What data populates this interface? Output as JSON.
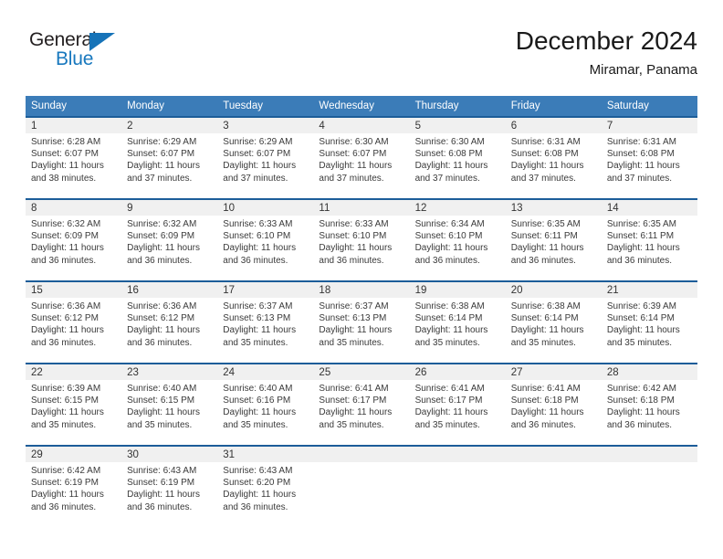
{
  "brand": {
    "name_part1": "General",
    "name_part2": "Blue",
    "triangle_color": "#1673b8",
    "text_color": "#231f20",
    "blue_color": "#1878be"
  },
  "header": {
    "title": "December 2024",
    "subtitle": "Miramar, Panama"
  },
  "theme": {
    "header_bar_color": "#3b7cb8",
    "row_divider_color": "#1c5d99",
    "day_band_color": "#f0f0f0"
  },
  "weekdays": [
    "Sunday",
    "Monday",
    "Tuesday",
    "Wednesday",
    "Thursday",
    "Friday",
    "Saturday"
  ],
  "weeks": [
    [
      {
        "day": "1",
        "sunrise": "Sunrise: 6:28 AM",
        "sunset": "Sunset: 6:07 PM",
        "daylight_line1": "Daylight: 11 hours",
        "daylight_line2": "and 38 minutes."
      },
      {
        "day": "2",
        "sunrise": "Sunrise: 6:29 AM",
        "sunset": "Sunset: 6:07 PM",
        "daylight_line1": "Daylight: 11 hours",
        "daylight_line2": "and 37 minutes."
      },
      {
        "day": "3",
        "sunrise": "Sunrise: 6:29 AM",
        "sunset": "Sunset: 6:07 PM",
        "daylight_line1": "Daylight: 11 hours",
        "daylight_line2": "and 37 minutes."
      },
      {
        "day": "4",
        "sunrise": "Sunrise: 6:30 AM",
        "sunset": "Sunset: 6:07 PM",
        "daylight_line1": "Daylight: 11 hours",
        "daylight_line2": "and 37 minutes."
      },
      {
        "day": "5",
        "sunrise": "Sunrise: 6:30 AM",
        "sunset": "Sunset: 6:08 PM",
        "daylight_line1": "Daylight: 11 hours",
        "daylight_line2": "and 37 minutes."
      },
      {
        "day": "6",
        "sunrise": "Sunrise: 6:31 AM",
        "sunset": "Sunset: 6:08 PM",
        "daylight_line1": "Daylight: 11 hours",
        "daylight_line2": "and 37 minutes."
      },
      {
        "day": "7",
        "sunrise": "Sunrise: 6:31 AM",
        "sunset": "Sunset: 6:08 PM",
        "daylight_line1": "Daylight: 11 hours",
        "daylight_line2": "and 37 minutes."
      }
    ],
    [
      {
        "day": "8",
        "sunrise": "Sunrise: 6:32 AM",
        "sunset": "Sunset: 6:09 PM",
        "daylight_line1": "Daylight: 11 hours",
        "daylight_line2": "and 36 minutes."
      },
      {
        "day": "9",
        "sunrise": "Sunrise: 6:32 AM",
        "sunset": "Sunset: 6:09 PM",
        "daylight_line1": "Daylight: 11 hours",
        "daylight_line2": "and 36 minutes."
      },
      {
        "day": "10",
        "sunrise": "Sunrise: 6:33 AM",
        "sunset": "Sunset: 6:10 PM",
        "daylight_line1": "Daylight: 11 hours",
        "daylight_line2": "and 36 minutes."
      },
      {
        "day": "11",
        "sunrise": "Sunrise: 6:33 AM",
        "sunset": "Sunset: 6:10 PM",
        "daylight_line1": "Daylight: 11 hours",
        "daylight_line2": "and 36 minutes."
      },
      {
        "day": "12",
        "sunrise": "Sunrise: 6:34 AM",
        "sunset": "Sunset: 6:10 PM",
        "daylight_line1": "Daylight: 11 hours",
        "daylight_line2": "and 36 minutes."
      },
      {
        "day": "13",
        "sunrise": "Sunrise: 6:35 AM",
        "sunset": "Sunset: 6:11 PM",
        "daylight_line1": "Daylight: 11 hours",
        "daylight_line2": "and 36 minutes."
      },
      {
        "day": "14",
        "sunrise": "Sunrise: 6:35 AM",
        "sunset": "Sunset: 6:11 PM",
        "daylight_line1": "Daylight: 11 hours",
        "daylight_line2": "and 36 minutes."
      }
    ],
    [
      {
        "day": "15",
        "sunrise": "Sunrise: 6:36 AM",
        "sunset": "Sunset: 6:12 PM",
        "daylight_line1": "Daylight: 11 hours",
        "daylight_line2": "and 36 minutes."
      },
      {
        "day": "16",
        "sunrise": "Sunrise: 6:36 AM",
        "sunset": "Sunset: 6:12 PM",
        "daylight_line1": "Daylight: 11 hours",
        "daylight_line2": "and 36 minutes."
      },
      {
        "day": "17",
        "sunrise": "Sunrise: 6:37 AM",
        "sunset": "Sunset: 6:13 PM",
        "daylight_line1": "Daylight: 11 hours",
        "daylight_line2": "and 35 minutes."
      },
      {
        "day": "18",
        "sunrise": "Sunrise: 6:37 AM",
        "sunset": "Sunset: 6:13 PM",
        "daylight_line1": "Daylight: 11 hours",
        "daylight_line2": "and 35 minutes."
      },
      {
        "day": "19",
        "sunrise": "Sunrise: 6:38 AM",
        "sunset": "Sunset: 6:14 PM",
        "daylight_line1": "Daylight: 11 hours",
        "daylight_line2": "and 35 minutes."
      },
      {
        "day": "20",
        "sunrise": "Sunrise: 6:38 AM",
        "sunset": "Sunset: 6:14 PM",
        "daylight_line1": "Daylight: 11 hours",
        "daylight_line2": "and 35 minutes."
      },
      {
        "day": "21",
        "sunrise": "Sunrise: 6:39 AM",
        "sunset": "Sunset: 6:14 PM",
        "daylight_line1": "Daylight: 11 hours",
        "daylight_line2": "and 35 minutes."
      }
    ],
    [
      {
        "day": "22",
        "sunrise": "Sunrise: 6:39 AM",
        "sunset": "Sunset: 6:15 PM",
        "daylight_line1": "Daylight: 11 hours",
        "daylight_line2": "and 35 minutes."
      },
      {
        "day": "23",
        "sunrise": "Sunrise: 6:40 AM",
        "sunset": "Sunset: 6:15 PM",
        "daylight_line1": "Daylight: 11 hours",
        "daylight_line2": "and 35 minutes."
      },
      {
        "day": "24",
        "sunrise": "Sunrise: 6:40 AM",
        "sunset": "Sunset: 6:16 PM",
        "daylight_line1": "Daylight: 11 hours",
        "daylight_line2": "and 35 minutes."
      },
      {
        "day": "25",
        "sunrise": "Sunrise: 6:41 AM",
        "sunset": "Sunset: 6:17 PM",
        "daylight_line1": "Daylight: 11 hours",
        "daylight_line2": "and 35 minutes."
      },
      {
        "day": "26",
        "sunrise": "Sunrise: 6:41 AM",
        "sunset": "Sunset: 6:17 PM",
        "daylight_line1": "Daylight: 11 hours",
        "daylight_line2": "and 35 minutes."
      },
      {
        "day": "27",
        "sunrise": "Sunrise: 6:41 AM",
        "sunset": "Sunset: 6:18 PM",
        "daylight_line1": "Daylight: 11 hours",
        "daylight_line2": "and 36 minutes."
      },
      {
        "day": "28",
        "sunrise": "Sunrise: 6:42 AM",
        "sunset": "Sunset: 6:18 PM",
        "daylight_line1": "Daylight: 11 hours",
        "daylight_line2": "and 36 minutes."
      }
    ],
    [
      {
        "day": "29",
        "sunrise": "Sunrise: 6:42 AM",
        "sunset": "Sunset: 6:19 PM",
        "daylight_line1": "Daylight: 11 hours",
        "daylight_line2": "and 36 minutes."
      },
      {
        "day": "30",
        "sunrise": "Sunrise: 6:43 AM",
        "sunset": "Sunset: 6:19 PM",
        "daylight_line1": "Daylight: 11 hours",
        "daylight_line2": "and 36 minutes."
      },
      {
        "day": "31",
        "sunrise": "Sunrise: 6:43 AM",
        "sunset": "Sunset: 6:20 PM",
        "daylight_line1": "Daylight: 11 hours",
        "daylight_line2": "and 36 minutes."
      },
      {
        "day": "",
        "sunrise": "",
        "sunset": "",
        "daylight_line1": "",
        "daylight_line2": ""
      },
      {
        "day": "",
        "sunrise": "",
        "sunset": "",
        "daylight_line1": "",
        "daylight_line2": ""
      },
      {
        "day": "",
        "sunrise": "",
        "sunset": "",
        "daylight_line1": "",
        "daylight_line2": ""
      },
      {
        "day": "",
        "sunrise": "",
        "sunset": "",
        "daylight_line1": "",
        "daylight_line2": ""
      }
    ]
  ]
}
